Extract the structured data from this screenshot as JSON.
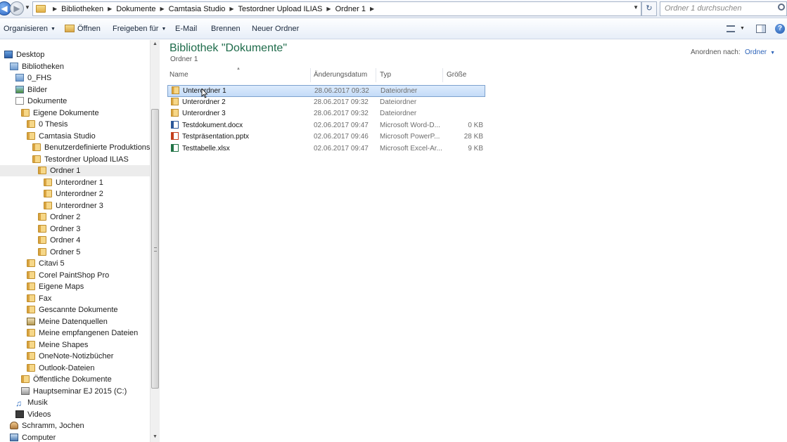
{
  "address": {
    "crumbs": [
      "Bibliotheken",
      "Dokumente",
      "Camtasia Studio",
      "Testordner Upload ILIAS",
      "Ordner 1"
    ],
    "search_placeholder": "Ordner 1 durchsuchen"
  },
  "toolbar": {
    "organize": "Organisieren",
    "open": "Öffnen",
    "share": "Freigeben für",
    "email": "E-Mail",
    "burn": "Brennen",
    "new_folder": "Neuer Ordner"
  },
  "nav": {
    "items": [
      {
        "label": "Desktop",
        "icon": "desktop-icon"
      },
      {
        "label": "Bibliotheken",
        "icon": "library-icon"
      },
      {
        "label": "0_FHS",
        "icon": "library-icon"
      },
      {
        "label": "Bilder",
        "icon": "pictures-icon"
      },
      {
        "label": "Dokumente",
        "icon": "documents-icon"
      },
      {
        "label": "Eigene Dokumente",
        "icon": "folder-icon"
      },
      {
        "label": "0 Thesis",
        "icon": "folder-icon"
      },
      {
        "label": "Camtasia Studio",
        "icon": "folder-icon"
      },
      {
        "label": "Benutzerdefinierte Produktionseinstellungen",
        "icon": "folder-icon"
      },
      {
        "label": "Testordner Upload ILIAS",
        "icon": "folder-icon"
      },
      {
        "label": "Ordner 1",
        "icon": "folder-icon"
      },
      {
        "label": "Unterordner 1",
        "icon": "folder-icon"
      },
      {
        "label": "Unterordner 2",
        "icon": "folder-icon"
      },
      {
        "label": "Unterordner 3",
        "icon": "folder-icon"
      },
      {
        "label": "Ordner 2",
        "icon": "folder-icon"
      },
      {
        "label": "Ordner 3",
        "icon": "folder-icon"
      },
      {
        "label": "Ordner 4",
        "icon": "folder-icon"
      },
      {
        "label": "Ordner 5",
        "icon": "folder-icon"
      },
      {
        "label": "Citavi 5",
        "icon": "folder-icon"
      },
      {
        "label": "Corel PaintShop Pro",
        "icon": "folder-icon"
      },
      {
        "label": "Eigene Maps",
        "icon": "folder-icon"
      },
      {
        "label": "Fax",
        "icon": "folder-icon"
      },
      {
        "label": "Gescannte Dokumente",
        "icon": "folder-icon"
      },
      {
        "label": "Meine Datenquellen",
        "icon": "data-sources-icon"
      },
      {
        "label": "Meine empfangenen Dateien",
        "icon": "folder-icon"
      },
      {
        "label": "Meine Shapes",
        "icon": "folder-icon"
      },
      {
        "label": "OneNote-Notizbücher",
        "icon": "folder-icon"
      },
      {
        "label": "Outlook-Dateien",
        "icon": "folder-icon"
      },
      {
        "label": "Öffentliche Dokumente",
        "icon": "folder-icon"
      },
      {
        "label": "Hauptseminar EJ 2015 (C:)",
        "icon": "drive-icon"
      },
      {
        "label": "Musik",
        "icon": "music-icon"
      },
      {
        "label": "Videos",
        "icon": "videos-icon"
      },
      {
        "label": "Schramm, Jochen",
        "icon": "user-icon"
      },
      {
        "label": "Computer",
        "icon": "computer-icon"
      }
    ]
  },
  "content": {
    "title": "Bibliothek \"Dokumente\"",
    "subtitle": "Ordner 1",
    "arrange_label": "Anordnen nach:",
    "arrange_value": "Ordner",
    "columns": [
      "Name",
      "Änderungsdatum",
      "Typ",
      "Größe"
    ],
    "files": [
      {
        "name": "Unterordner 1",
        "date": "28.06.2017 09:32",
        "type": "Dateiordner",
        "size": "",
        "icon": "folder-icon"
      },
      {
        "name": "Unterordner 2",
        "date": "28.06.2017 09:32",
        "type": "Dateiordner",
        "size": "",
        "icon": "folder-icon"
      },
      {
        "name": "Unterordner 3",
        "date": "28.06.2017 09:32",
        "type": "Dateiordner",
        "size": "",
        "icon": "folder-icon"
      },
      {
        "name": "Testdokument.docx",
        "date": "02.06.2017 09:47",
        "type": "Microsoft Word-D...",
        "size": "0 KB",
        "icon": "word-document-icon"
      },
      {
        "name": "Testpräsentation.pptx",
        "date": "02.06.2017 09:46",
        "type": "Microsoft PowerP...",
        "size": "28 KB",
        "icon": "powerpoint-file-icon"
      },
      {
        "name": "Testtabelle.xlsx",
        "date": "02.06.2017 09:47",
        "type": "Microsoft Excel-Ar...",
        "size": "9 KB",
        "icon": "excel-file-icon"
      }
    ]
  },
  "colors": {
    "title_green": "#1e6b4a",
    "link_blue": "#2c63b9",
    "selection_border": "#7da2ce"
  }
}
